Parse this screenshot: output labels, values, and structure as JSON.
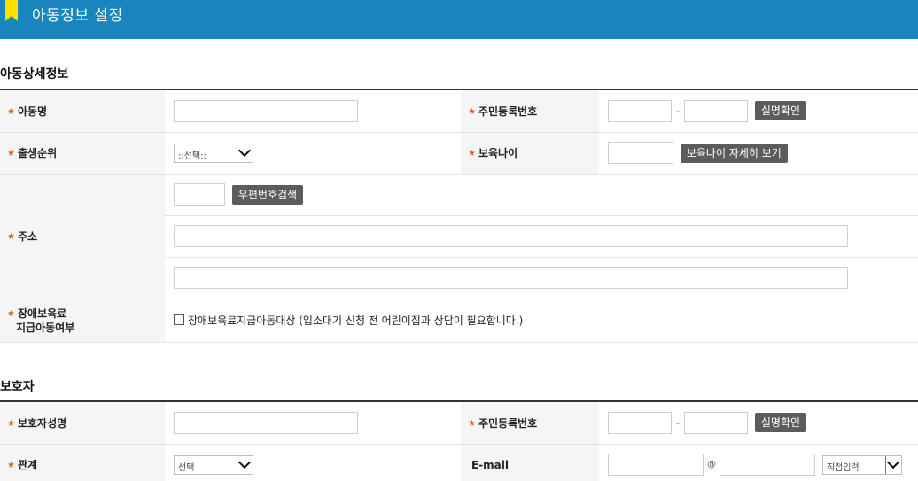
{
  "header": {
    "title": "아동정보 설정"
  },
  "child": {
    "section_title": "아동상세정보",
    "name_label": "아동명",
    "rrn_label": "주민등록번호",
    "verify_button": "실명확인",
    "birth_order_label": "출생순위",
    "birth_order_select": "::선택::",
    "age_label": "보육나이",
    "age_detail_button": "보육나이 자세히 보기",
    "address_label": "주소",
    "zip_search_button": "우편번호검색",
    "disability_label_line1": "장애보육료",
    "disability_label_line2": "지급아동여부",
    "disability_checkbox_label": "장애보육료지급아동대상 (입소대기 신청 전 어린이집과 상담이 필요합니다.)"
  },
  "guardian": {
    "section_title": "보호자",
    "name_label": "보호자성명",
    "rrn_label": "주민등록번호",
    "verify_button": "실명확인",
    "relation_label": "관계",
    "relation_select": "선택",
    "email_label": "E-mail",
    "email_at": "@",
    "email_domain_select": "직접입력"
  },
  "colors": {
    "header_bg": "#1a86bf",
    "accent_star": "#e35b16",
    "button_bg": "#5c5c5c"
  }
}
